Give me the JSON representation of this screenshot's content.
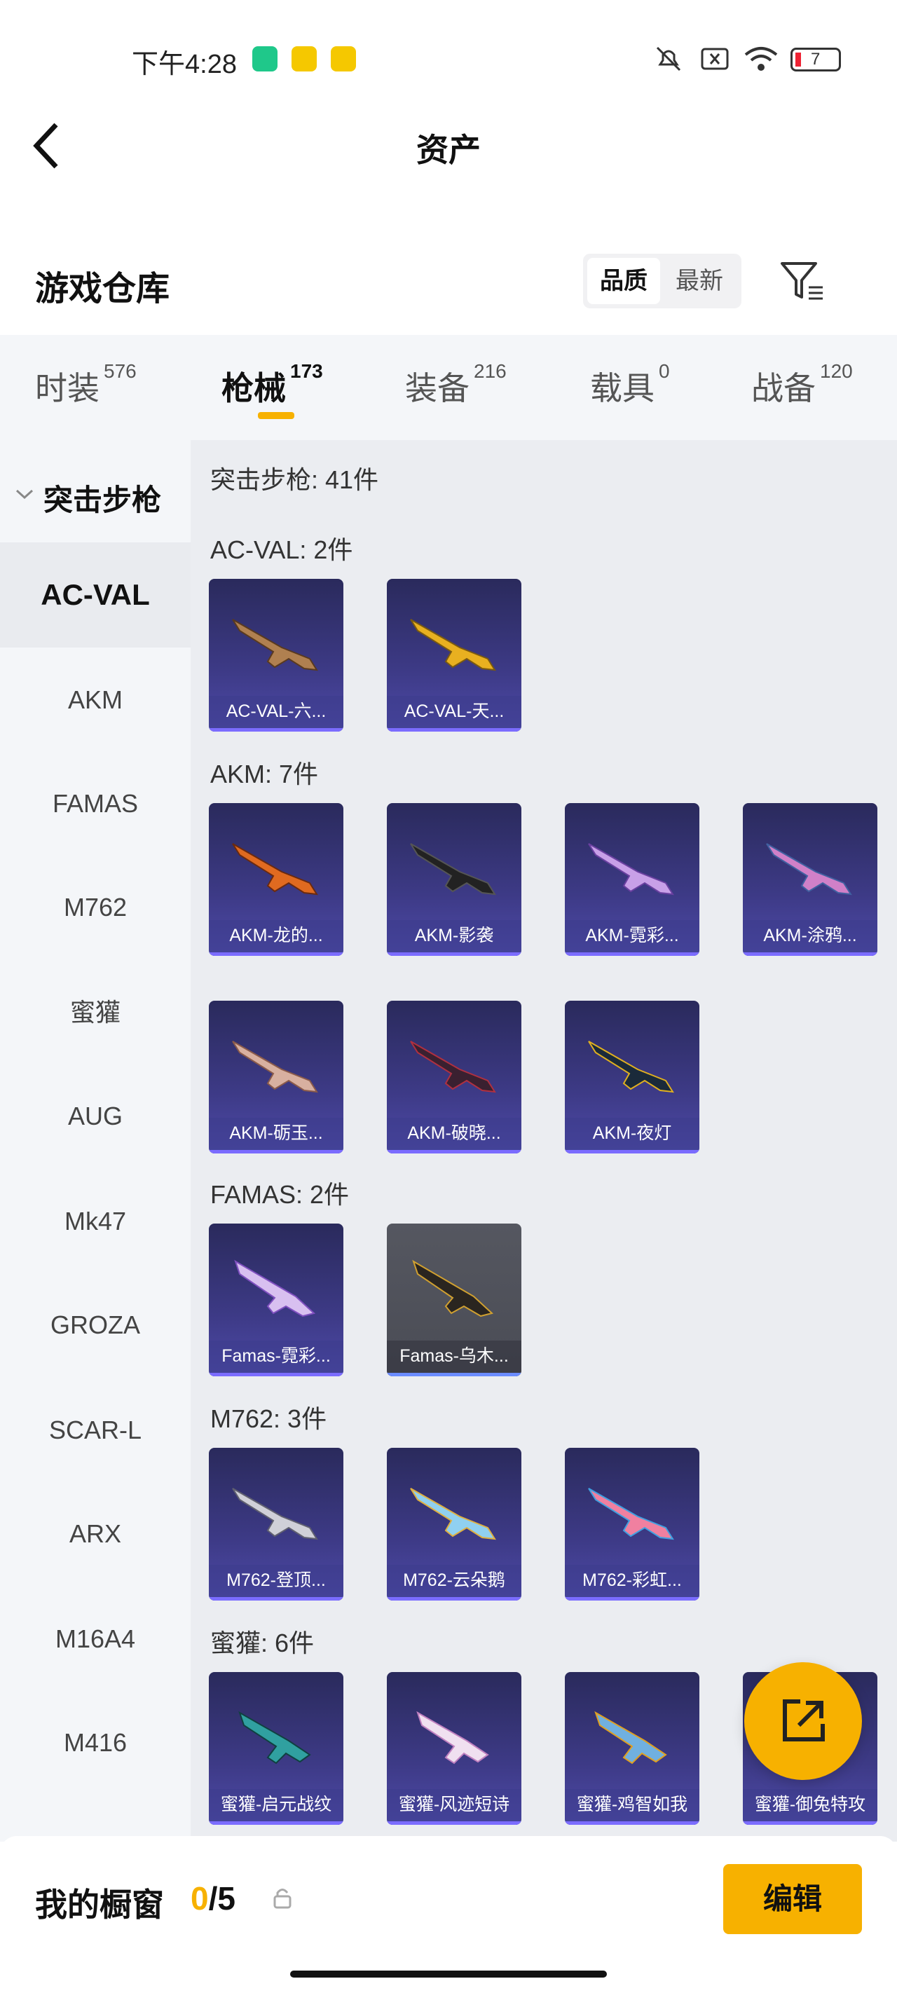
{
  "status_bar": {
    "time": "下午4:28",
    "battery": "7"
  },
  "header": {
    "title": "资产"
  },
  "section": {
    "title": "游戏仓库",
    "sort_quality": "品质",
    "sort_newest": "最新"
  },
  "tabs": [
    {
      "label": "时装",
      "count": "576"
    },
    {
      "label": "枪械",
      "count": "173"
    },
    {
      "label": "装备",
      "count": "216"
    },
    {
      "label": "载具",
      "count": "0"
    },
    {
      "label": "战备",
      "count": "120"
    }
  ],
  "sidebar": {
    "group": "突击步枪",
    "items": [
      "AC-VAL",
      "AKM",
      "FAMAS",
      "M762",
      "蜜獾",
      "AUG",
      "Mk47",
      "GROZA",
      "SCAR-L",
      "ARX",
      "M16A4",
      "M416"
    ]
  },
  "content": {
    "summary": "突击步枪: 41件",
    "groups": [
      {
        "title": "AC-VAL: 2件",
        "items": [
          "AC-VAL-六...",
          "AC-VAL-天..."
        ]
      },
      {
        "title": "AKM: 7件",
        "items": [
          "AKM-龙的...",
          "AKM-影袭",
          "AKM-霓彩...",
          "AKM-涂鸦...",
          "AKM-砺玉...",
          "AKM-破晓...",
          "AKM-夜灯"
        ]
      },
      {
        "title": "FAMAS: 2件",
        "items": [
          "Famas-霓彩...",
          "Famas-乌木..."
        ]
      },
      {
        "title": "M762: 3件",
        "items": [
          "M762-登顶...",
          "M762-云朵鹅",
          "M762-彩虹..."
        ]
      },
      {
        "title": "蜜獾: 6件",
        "items": [
          "蜜獾-启元战纹",
          "蜜獾-风迹短诗",
          "蜜獾-鸡智如我",
          "蜜獾-御兔特攻"
        ]
      }
    ]
  },
  "bottom": {
    "label": "我的橱窗",
    "current": "0",
    "total": "/5",
    "edit": "编辑"
  },
  "colors": {
    "accent": "#f7b100",
    "card_bg": "#3d3a86"
  }
}
